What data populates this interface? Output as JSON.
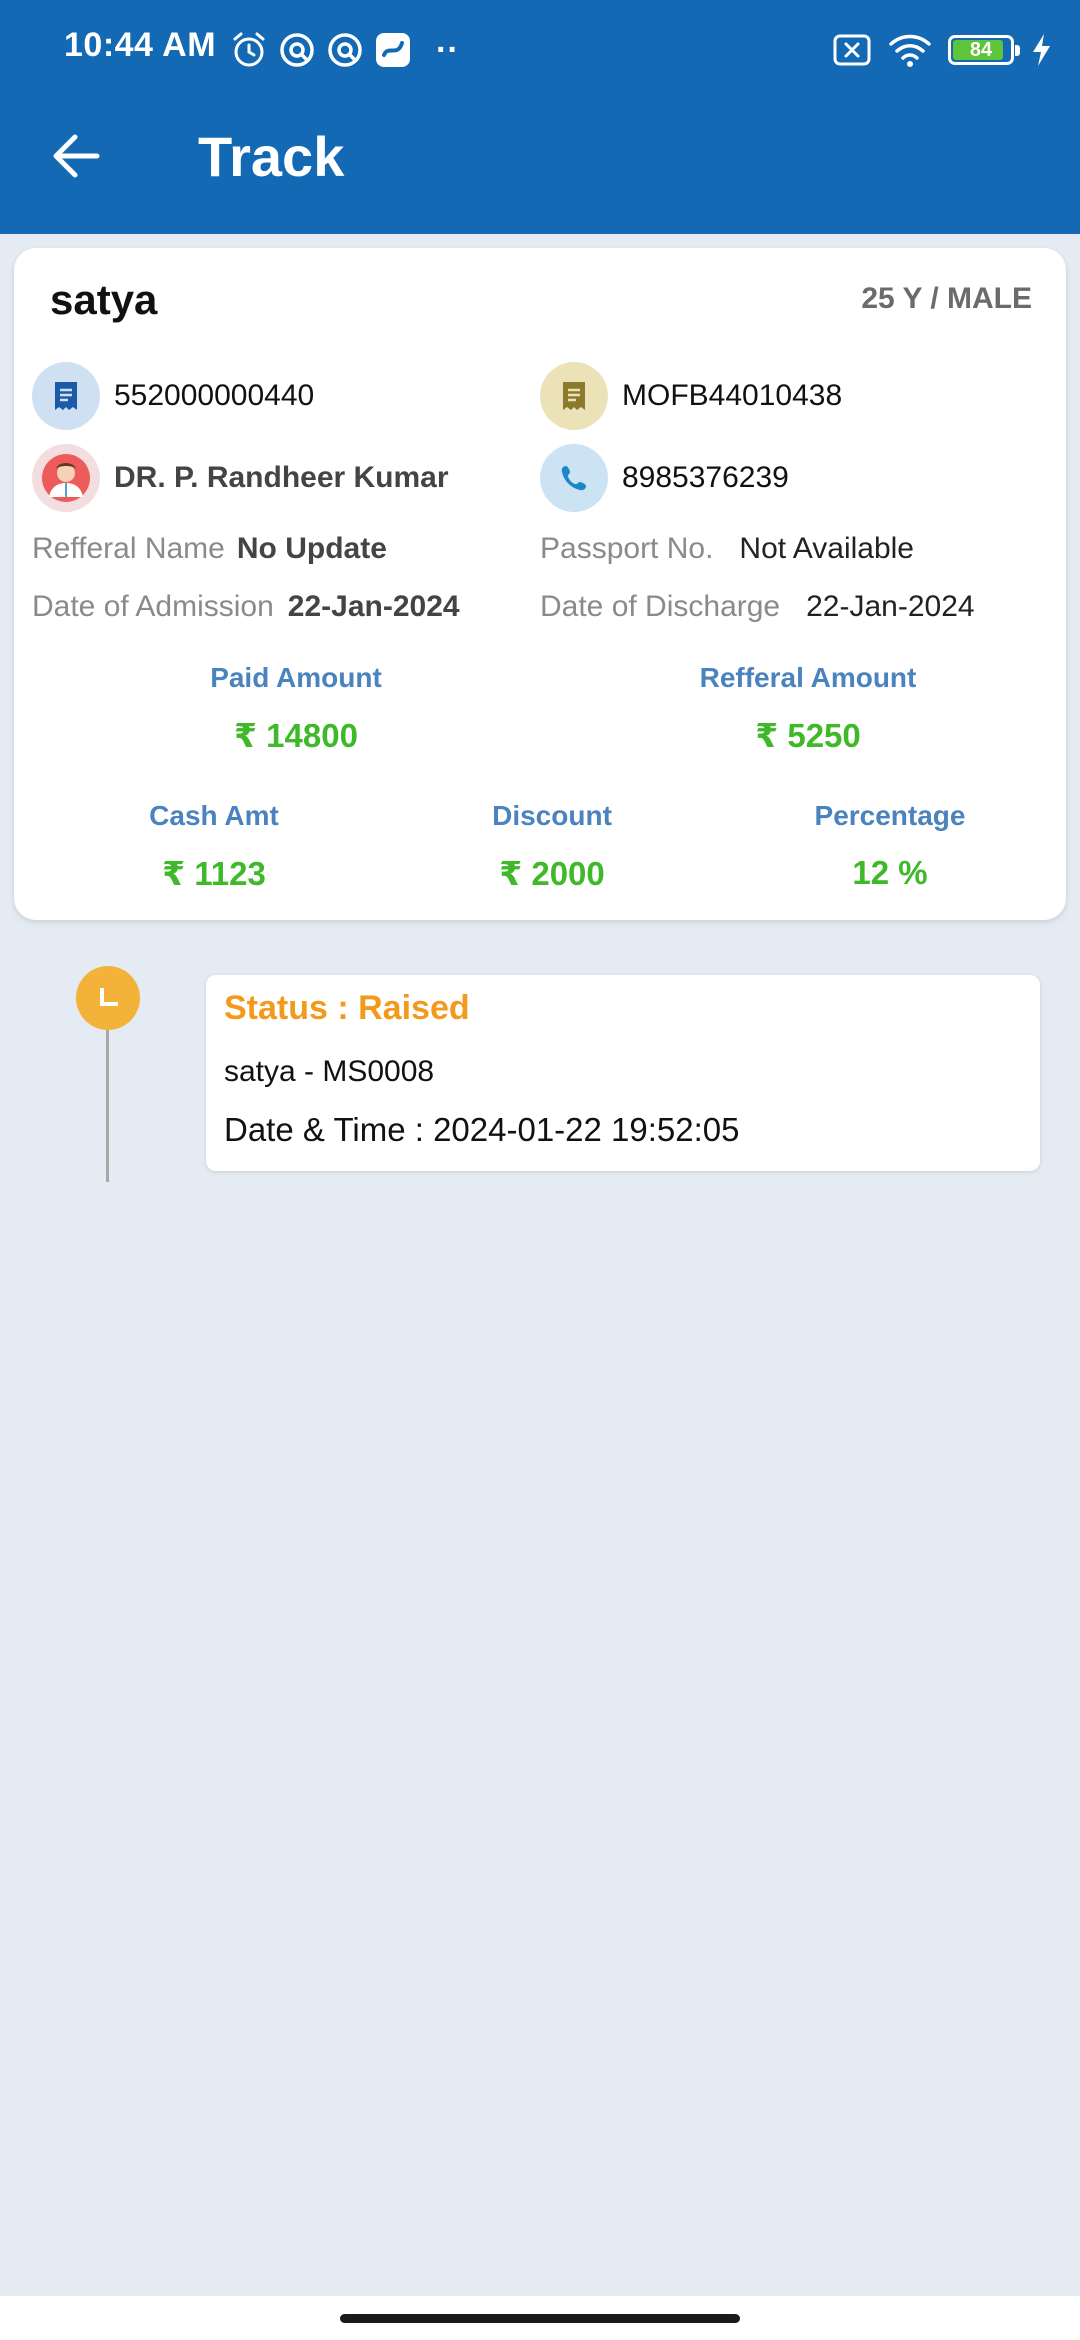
{
  "status_bar": {
    "time": "10:44 AM",
    "overflow": "··",
    "battery_level": "84",
    "battery_fraction": 0.84,
    "left_icons": [
      "alarm-icon",
      "app-notification-icon",
      "app-notification-icon",
      "app-notification-icon"
    ],
    "right_icons": [
      "no-sim-icon",
      "wifi-icon",
      "battery-icon",
      "charging-icon"
    ]
  },
  "header": {
    "title": "Track",
    "back_icon": "arrow-left-icon"
  },
  "patient": {
    "name": "satya",
    "age_gender": "25 Y / MALE",
    "bill_no": "552000000440",
    "mof_no": "MOFB44010438",
    "doctor": "DR. P. Randheer Kumar",
    "phone": "8985376239",
    "referral_name_label": "Refferal Name",
    "referral_name": "No Update",
    "passport_label": "Passport No.",
    "passport": "Not Available",
    "admission_label": "Date of Admission",
    "admission_date": "22-Jan-2024",
    "discharge_label": "Date of Discharge",
    "discharge_date": "22-Jan-2024"
  },
  "amounts": {
    "paid_label": "Paid Amount",
    "paid_value": "₹ 14800",
    "referral_label": "Refferal Amount",
    "referral_value": "₹ 5250",
    "cash_label": "Cash Amt",
    "cash_value": "₹ 1123",
    "discount_label": "Discount",
    "discount_value": "₹ 2000",
    "percentage_label": "Percentage",
    "percentage_value": "12 %"
  },
  "timeline": [
    {
      "status": "Status : Raised",
      "reference": "satya - MS0008",
      "datetime": "Date & Time : 2024-01-22 19:52:05",
      "icon": "clock-icon"
    }
  ],
  "colors": {
    "appbar": "#1469b5",
    "page_bg": "#e4ebf3",
    "label_blue": "#4a83bd",
    "amount_green": "#3fb82a",
    "status_orange": "#f39a1c",
    "timeline_dot": "#f3b33b"
  }
}
